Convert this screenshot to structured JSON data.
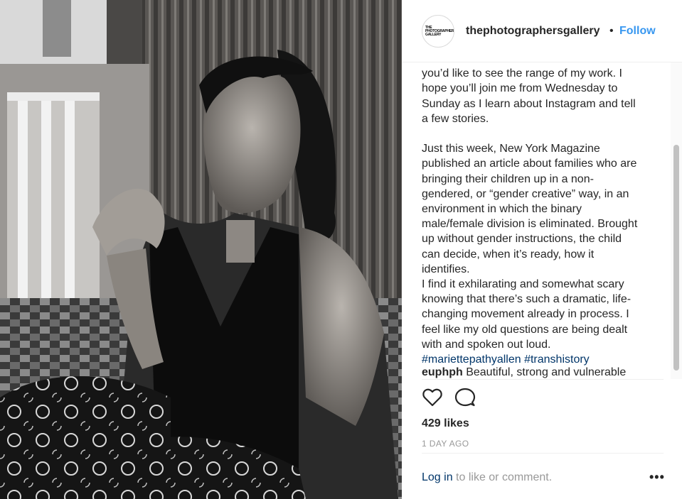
{
  "post": {
    "image_description": "black-and-white portrait",
    "username": "thephotographersgallery",
    "separator": "•",
    "follow_label": "Follow",
    "avatar_text": "THE\nPHOTOGRAPHERS'\nGALLERY",
    "caption": "you’d like to see the range of my work. I\nhope you’ll join me from Wednesday to\nSunday as I learn about Instagram and tell\na few stories.\n\nJust this week, New York Magazine\npublished an article about families who are\nbringing their children up in a non-\ngendered, or “gender creative” way, in an\nenvironment in which the binary\nmale/female division is eliminated. Brought\nup without gender instructions, the child\ncan decide, when it’s ready, how it\nidentifies.\nI find it exhilarating and somewhat scary\nknowing that there’s such a dramatic, life-\nchanging movement already in process. I\nfeel like my old questions are being dealt\nwith and spoken out loud.",
    "hashtags": "#mariettepathyallen #transhistory",
    "comment": {
      "user": "euphph",
      "text": " Beautiful, strong and vulnerable"
    },
    "likes": "429 likes",
    "time_ago": "1 DAY AGO",
    "login_link": "Log in",
    "login_rest": " to like or comment.",
    "more_label": "•••",
    "icons": {
      "like": "heart-icon",
      "comment": "comment-bubble-icon",
      "more": "more-options-icon"
    },
    "colors": {
      "link": "#3897f0",
      "hashtag": "#003569",
      "muted": "#999999",
      "text": "#262626"
    }
  }
}
